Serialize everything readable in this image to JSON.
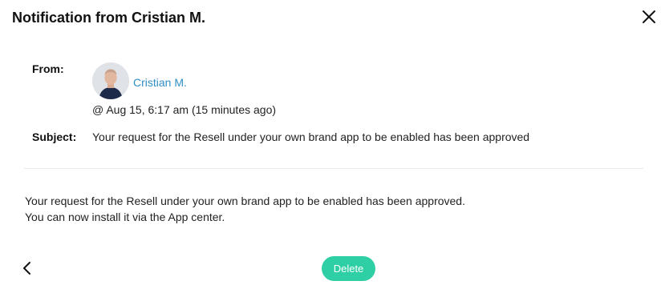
{
  "dialog": {
    "title": "Notification from Cristian M.",
    "close_icon": "close-icon"
  },
  "message": {
    "from_label": "From:",
    "sender_name": "Cristian M.",
    "timestamp": "@ Aug 15, 6:17 am (15 minutes ago)",
    "subject_label": "Subject:",
    "subject": "Your request for the Resell under your own brand app to be enabled has been approved",
    "body_line1": "Your request for the Resell under your own brand app to be enabled has been approved.",
    "body_line2": "You can now install it via the App center."
  },
  "footer": {
    "back_icon": "chevron-left-icon",
    "delete_label": "Delete"
  },
  "colors": {
    "link": "#2f8fc4",
    "delete_button": "#2fcfa5"
  }
}
